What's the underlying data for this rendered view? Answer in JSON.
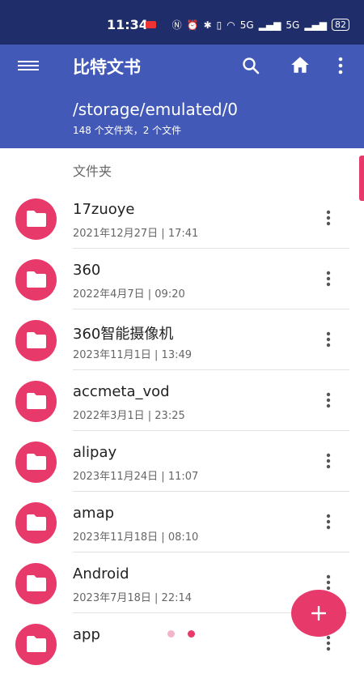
{
  "status": {
    "time": "11:34",
    "battery": "82",
    "network": "5G"
  },
  "app": {
    "title": "比特文书"
  },
  "path": {
    "text": "/storage/emulated/0",
    "subtitle": "148 个文件夹，2 个文件"
  },
  "section": {
    "label": "文件夹"
  },
  "files": [
    {
      "name": "17zuoye",
      "date": "2021年12月27日 | 17:41"
    },
    {
      "name": "360",
      "date": "2022年4月7日 | 09:20"
    },
    {
      "name": "360智能摄像机",
      "date": "2023年11月1日 | 13:49"
    },
    {
      "name": "accmeta_vod",
      "date": "2022年3月1日 | 23:25"
    },
    {
      "name": "alipay",
      "date": "2023年11月24日 | 11:07"
    },
    {
      "name": "amap",
      "date": "2023年11月18日 | 08:10"
    },
    {
      "name": "Android",
      "date": "2023年7月18日 | 22:14"
    },
    {
      "name": "app",
      "date": ""
    }
  ],
  "fab": {
    "icon": "plus-icon"
  },
  "colors": {
    "app_bar": "#4259b8",
    "status_bar": "#1f2d6b",
    "accent": "#e8396b"
  }
}
